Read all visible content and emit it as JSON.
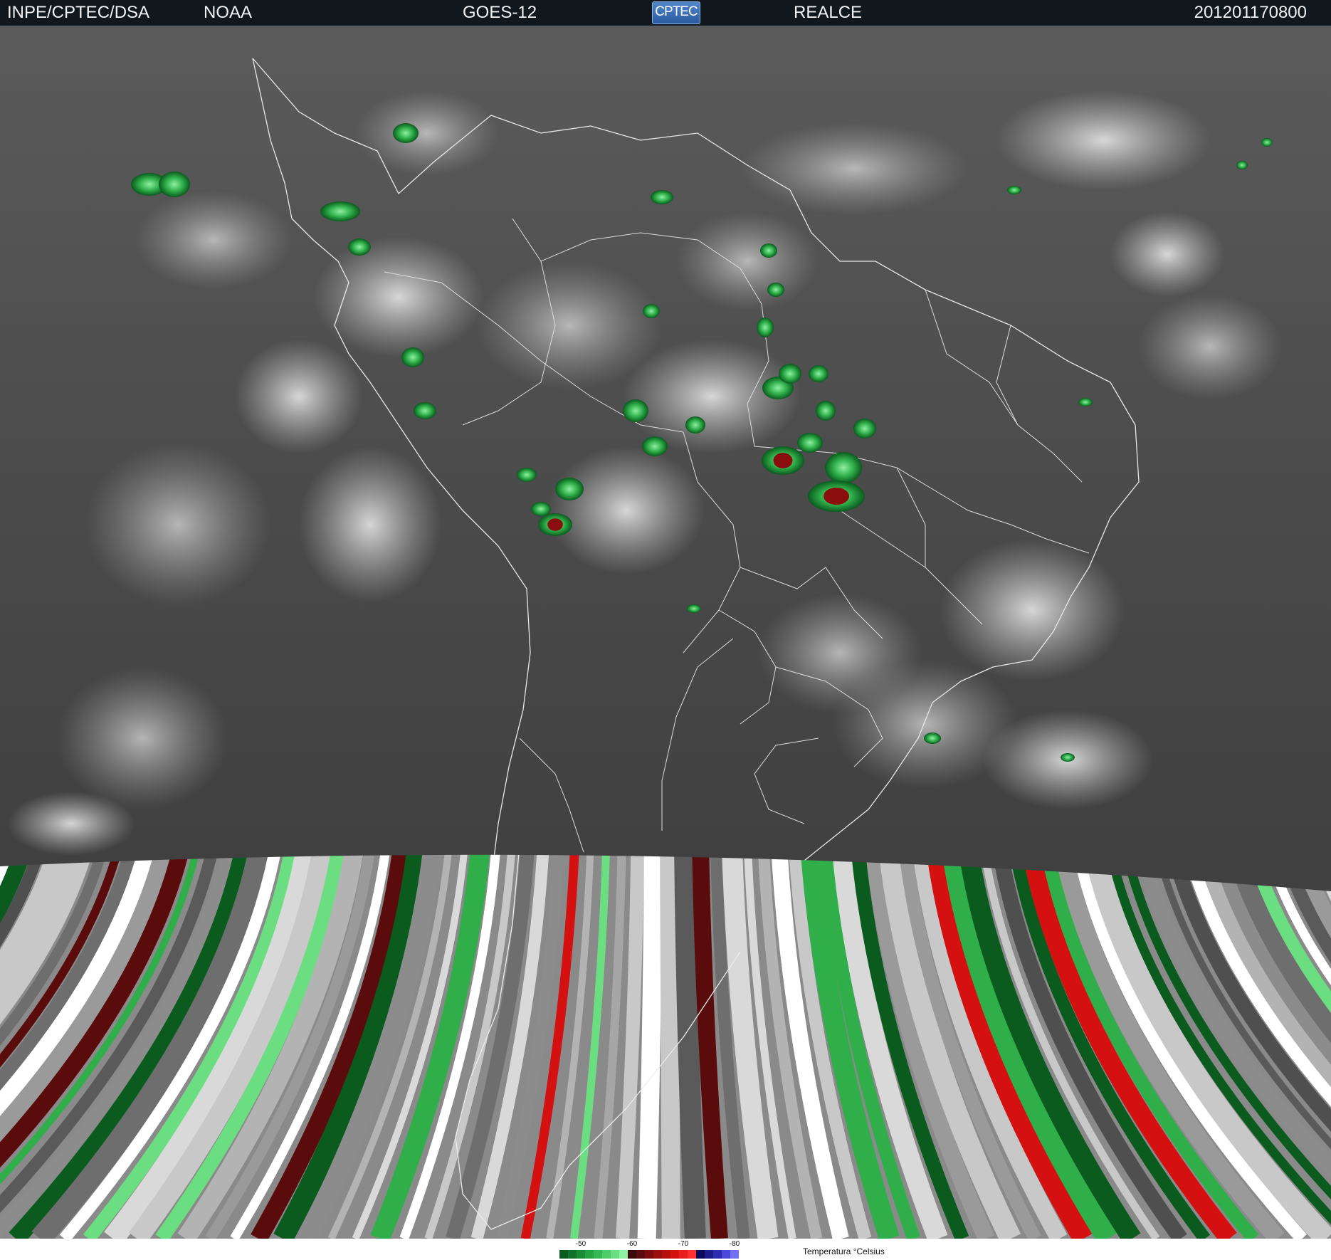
{
  "header": {
    "org": "INPE/CPTEC/DSA",
    "agency": "NOAA",
    "satellite": "GOES-12",
    "logo_text": "CPTEC",
    "mode": "REALCE",
    "timestamp": "201201170800"
  },
  "legend": {
    "title": "Temperatura °Celsius",
    "ticks": [
      {
        "label": "-50",
        "index": 2
      },
      {
        "label": "-60",
        "index": 8
      },
      {
        "label": "-70",
        "index": 14
      },
      {
        "label": "-80",
        "index": 20
      }
    ],
    "colors": [
      "#0b5a1e",
      "#11702a",
      "#1a8a36",
      "#27a343",
      "#38b854",
      "#4fcc68",
      "#6ade80",
      "#8ef0a0",
      "#3a0a0a",
      "#5a0c0c",
      "#7a0d0d",
      "#9a0e0e",
      "#b80f0f",
      "#d41010",
      "#e81e1e",
      "#ff3030",
      "#0a0a5a",
      "#1b1b8a",
      "#2c2cb0",
      "#4a4ad6",
      "#7070f0"
    ]
  },
  "map": {
    "features": [
      "storm-cells",
      "country-borders",
      "coastlines",
      "scan-artifact-bands"
    ]
  }
}
